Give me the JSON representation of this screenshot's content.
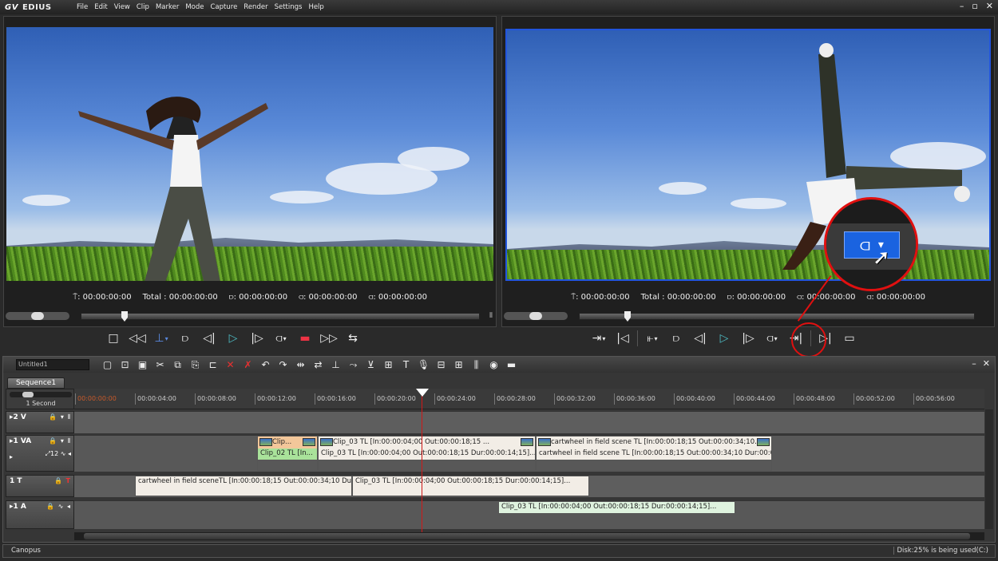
{
  "app": {
    "name": "EDIUS",
    "logo_glyph": "GV",
    "window_controls": [
      "–",
      "▫",
      "✕"
    ]
  },
  "menu": [
    "File",
    "Edit",
    "View",
    "Clip",
    "Marker",
    "Mode",
    "Capture",
    "Render",
    "Settings",
    "Help"
  ],
  "player": {
    "timecode_cur": ": 00:00:00:00",
    "total": "Total : 00:00:00:00",
    "in": ": 00:00:00:00",
    "out": ": 00:00:00:00",
    "dur": ": 00:00:00:00",
    "transport": [
      "□",
      "◁◁",
      "⊥",
      "▼",
      "⫐",
      "◁|",
      "▷",
      "|▷",
      "⫏",
      "▼",
      "▬",
      "▷▷",
      "⇆"
    ]
  },
  "recorder": {
    "timecode_cur": ": 00:00:00:00",
    "total": "Total : 00:00:00:00",
    "in": ": 00:00:00:00",
    "out": ": 00:00:00:00",
    "dur": ": 00:00:00:00"
  },
  "callout": {
    "icon": "out-point-icon",
    "glyph": "⫏",
    "dropdown_glyph": "▾",
    "highlight_color": "#e01010"
  },
  "timeline": {
    "project_name": "Untitled1",
    "sequence_tab": "Sequence1",
    "scale_label": "1 Second",
    "ruler": [
      "00:00:00:00",
      "00:00:04:00",
      "00:00:08:00",
      "00:00:12:00",
      "00:00:16:00",
      "00:00:20:00",
      "00:00:24:00",
      "00:00:28:00",
      "00:00:32:00",
      "00:00:36:00",
      "00:00:40:00",
      "00:00:44:00",
      "00:00:48:00",
      "00:00:52:00",
      "00:00:56:00"
    ],
    "tracks": [
      {
        "name": "2 V",
        "controls": "🔒 ▾ ⦀"
      },
      {
        "name": "1 VA",
        "controls": "🔒 ▾ ⦀",
        "sub": "⤢12 ∿ ◂"
      },
      {
        "name": "1 T",
        "controls": "🔒",
        "t_glyph": "T"
      },
      {
        "name": "1 A",
        "controls": "🔒 ∿ ◂"
      }
    ],
    "clips_va": [
      {
        "top": "Clip...",
        "bottom": "Clip_02  TL [In...",
        "color_top": "#f3c79a",
        "color_bot": "#a9e29a"
      },
      {
        "top": "Clip_03  TL [In:00:00:04;00 Out:00:00:18;15 ...",
        "bottom": "Clip_03  TL [In:00:00:04;00 Out:00:00:18;15 Dur:00:00:14;15]...",
        "color_top": "#f2ede6",
        "color_bot": "#f2ede6"
      },
      {
        "top": "cartwheel in field scene TL [In:00:00:18;15 Out:00:00:34;10...",
        "bottom": "cartwheel in field scene TL [In:00:00:18;15 Out:00:00:34;10 Dur:00:00:...",
        "color_top": "#f2ede6",
        "color_bot": "#f2ede6"
      }
    ],
    "clips_t": [
      "cartwheel in field sceneTL [In:00:00:18;15 Out:00:00:34;10 Dur:0",
      "Clip_03  TL [In:00:00:04;00 Out:00:00:18;15 Dur:00:00:14;15]..."
    ],
    "clip_a": "Clip_03  TL [In:00:00:04;00 Out:00:00:18;15 Dur:00:00:14;15]..."
  },
  "status": {
    "left": "Canopus",
    "right": "Disk:25% is being used(C:)"
  }
}
